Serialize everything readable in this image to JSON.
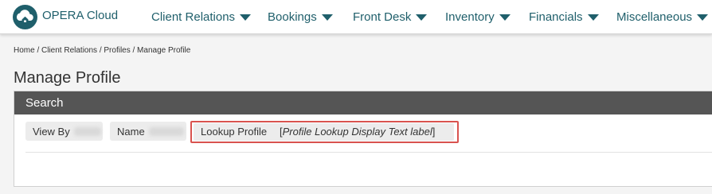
{
  "app": {
    "name": "OPERA Cloud",
    "logo_icon": "cloud-home-icon",
    "brand_color": "#1f5f6b"
  },
  "nav": {
    "items": [
      {
        "label": "Client Relations"
      },
      {
        "label": "Bookings"
      },
      {
        "label": "Front Desk"
      },
      {
        "label": "Inventory"
      },
      {
        "label": "Financials"
      },
      {
        "label": "Miscellaneous"
      }
    ]
  },
  "breadcrumb": "Home / Client Relations / Profiles / Manage Profile",
  "page_title": "Manage Profile",
  "search_panel": {
    "title": "Search",
    "header_color": "#555555",
    "filters": [
      {
        "label": "View By"
      },
      {
        "label": "Name"
      }
    ],
    "lookup": {
      "label": "Lookup Profile",
      "value_prefix": "[",
      "value_text": "Profile Lookup Display Text label",
      "value_suffix": "]",
      "highlight_color": "#d9534f"
    }
  }
}
